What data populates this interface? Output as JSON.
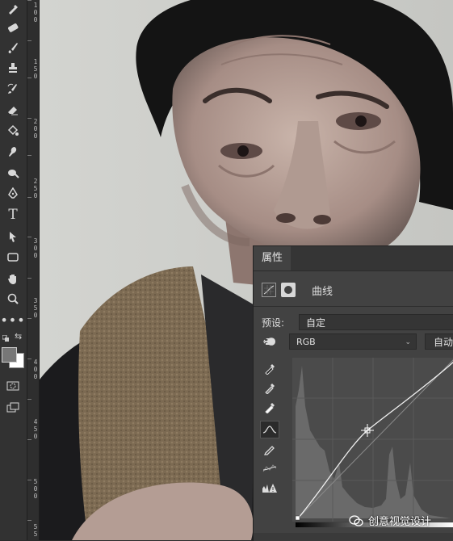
{
  "toolbar": {
    "tools": [
      "eyedropper-icon",
      "healing-brush-icon",
      "brush-icon",
      "stamp-icon",
      "history-brush-icon",
      "eraser-icon",
      "paint-bucket-icon",
      "blur-icon",
      "dodge-icon",
      "pen-icon",
      "type-icon",
      "path-select-icon",
      "rectangle-icon",
      "hand-icon",
      "zoom-icon",
      "more-icon"
    ],
    "type_glyph": "T"
  },
  "ruler": {
    "labels": [
      "1",
      "0",
      "0",
      "1",
      "5",
      "0",
      "2",
      "0",
      "0",
      "2",
      "5",
      "0",
      "3",
      "0",
      "0",
      "3",
      "5",
      "0",
      "4",
      "0",
      "0",
      "4",
      "5",
      "0",
      "5",
      "0",
      "0",
      "5",
      "5",
      "0"
    ]
  },
  "panel": {
    "tab_label": "属性",
    "adjustment_title": "曲线",
    "preset_label": "预设:",
    "preset_value": "自定",
    "channel_value": "RGB",
    "auto_label": "自动"
  },
  "curve": {
    "point": [
      0.52,
      0.55
    ],
    "histogram": "dark-skewed"
  },
  "watermark": {
    "text": "创意视觉设计"
  }
}
